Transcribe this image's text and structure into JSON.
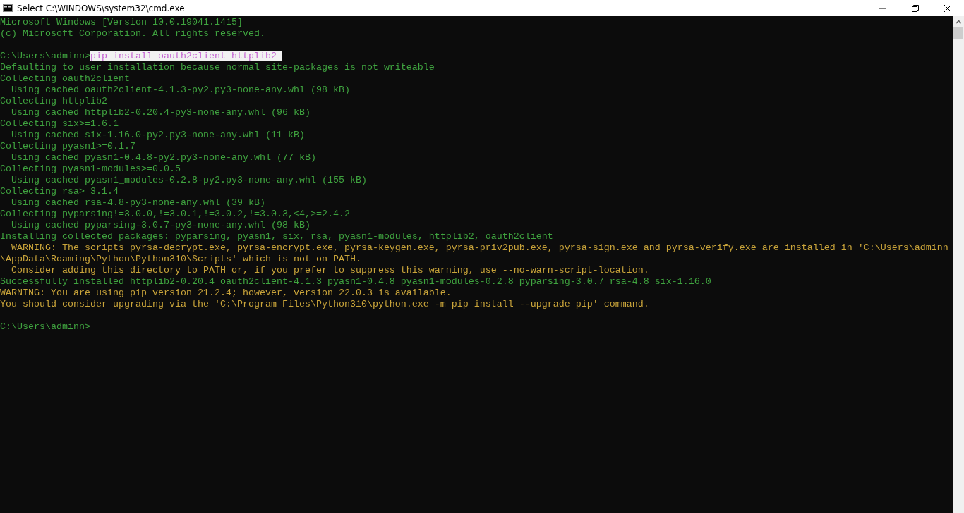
{
  "window": {
    "title": "Select C:\\WINDOWS\\system32\\cmd.exe"
  },
  "console": {
    "lines": [
      {
        "kind": "output",
        "text": "Microsoft Windows [Version 10.0.19041.1415]"
      },
      {
        "kind": "output",
        "text": "(c) Microsoft Corporation. All rights reserved."
      },
      {
        "kind": "blank"
      },
      {
        "kind": "prompt",
        "prompt": "C:\\Users\\adminn>",
        "command": "pip install oauth2client httplib2 ",
        "selected": true
      },
      {
        "kind": "output",
        "text": "Defaulting to user installation because normal site-packages is not writeable"
      },
      {
        "kind": "output",
        "text": "Collecting oauth2client"
      },
      {
        "kind": "output",
        "text": "  Using cached oauth2client-4.1.3-py2.py3-none-any.whl (98 kB)"
      },
      {
        "kind": "output",
        "text": "Collecting httplib2"
      },
      {
        "kind": "output",
        "text": "  Using cached httplib2-0.20.4-py3-none-any.whl (96 kB)"
      },
      {
        "kind": "output",
        "text": "Collecting six>=1.6.1"
      },
      {
        "kind": "output",
        "text": "  Using cached six-1.16.0-py2.py3-none-any.whl (11 kB)"
      },
      {
        "kind": "output",
        "text": "Collecting pyasn1>=0.1.7"
      },
      {
        "kind": "output",
        "text": "  Using cached pyasn1-0.4.8-py2.py3-none-any.whl (77 kB)"
      },
      {
        "kind": "output",
        "text": "Collecting pyasn1-modules>=0.0.5"
      },
      {
        "kind": "output",
        "text": "  Using cached pyasn1_modules-0.2.8-py2.py3-none-any.whl (155 kB)"
      },
      {
        "kind": "output",
        "text": "Collecting rsa>=3.1.4"
      },
      {
        "kind": "output",
        "text": "  Using cached rsa-4.8-py3-none-any.whl (39 kB)"
      },
      {
        "kind": "output",
        "text": "Collecting pyparsing!=3.0.0,!=3.0.1,!=3.0.2,!=3.0.3,<4,>=2.4.2"
      },
      {
        "kind": "output",
        "text": "  Using cached pyparsing-3.0.7-py3-none-any.whl (98 kB)"
      },
      {
        "kind": "output",
        "text": "Installing collected packages: pyparsing, pyasn1, six, rsa, pyasn1-modules, httplib2, oauth2client"
      },
      {
        "kind": "warning",
        "text": "  WARNING: The scripts pyrsa-decrypt.exe, pyrsa-encrypt.exe, pyrsa-keygen.exe, pyrsa-priv2pub.exe, pyrsa-sign.exe and pyrsa-verify.exe are installed in 'C:\\Users\\adminn"
      },
      {
        "kind": "warning",
        "text": "\\AppData\\Roaming\\Python\\Python310\\Scripts' which is not on PATH."
      },
      {
        "kind": "warning",
        "text": "  Consider adding this directory to PATH or, if you prefer to suppress this warning, use --no-warn-script-location."
      },
      {
        "kind": "output",
        "text": "Successfully installed httplib2-0.20.4 oauth2client-4.1.3 pyasn1-0.4.8 pyasn1-modules-0.2.8 pyparsing-3.0.7 rsa-4.8 six-1.16.0"
      },
      {
        "kind": "warning",
        "text": "WARNING: You are using pip version 21.2.4; however, version 22.0.3 is available."
      },
      {
        "kind": "warning",
        "text": "You should consider upgrading via the 'C:\\Program Files\\Python310\\python.exe -m pip install --upgrade pip' command."
      },
      {
        "kind": "blank"
      },
      {
        "kind": "prompt",
        "prompt": "C:\\Users\\adminn>"
      }
    ]
  }
}
